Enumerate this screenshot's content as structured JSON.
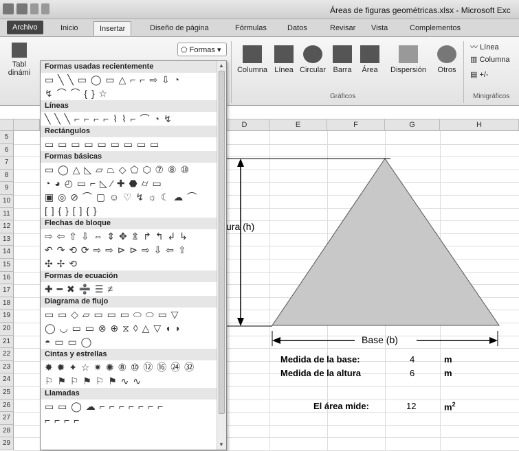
{
  "window": {
    "title": "Áreas de figuras geométricas.xlsx - Microsoft Exc"
  },
  "tabs": [
    "Archivo",
    "Inicio",
    "Insertar",
    "Diseño de página",
    "Fórmulas",
    "Datos",
    "Revisar",
    "Vista",
    "Complementos"
  ],
  "ribbon": {
    "tabla_line1": "Tabl",
    "tabla_line2": "dinámi",
    "formas_label": "Formas",
    "charts": [
      "Columna",
      "Línea",
      "Circular",
      "Barra",
      "Área",
      "Dispersión",
      "Otros"
    ],
    "charts_group": "Gráficos",
    "sparklines": [
      "Línea",
      "Columna",
      "+/-"
    ],
    "sparklines_group": "Minigráficos"
  },
  "shapes_panel": {
    "sections": [
      {
        "title": "Formas usadas recientemente",
        "glyphs": [
          "▭ ╲ ╲ ▭ ◯ ▭ △ ⌐ ⌐ ⇨ ⇩ ◔",
          "↯ ⌒ ⌒ { } ☆"
        ]
      },
      {
        "title": "Líneas",
        "glyphs": [
          "╲ ╲ ╲ ⌐ ⌐ ⌐ ⌐ ⌇ ⌇ ⌐ ⌒ ◔ ↯"
        ]
      },
      {
        "title": "Rectángulos",
        "glyphs": [
          "▭ ▭ ▭ ▭ ▭ ▭ ▭ ▭ ▭"
        ]
      },
      {
        "title": "Formas básicas",
        "glyphs": [
          "▭ ◯ △ ◺ ▱ ⏢ ◇ ⬠ ⬡ ⑦ ⑧ ⑩",
          "◔ ◕ ◴ ▭ ⌐ ◺ ⁄ ✚ ⬣ ⌭ ▭",
          "▣ ◎ ⊘ ⌒ ▢ ☺ ♡ ↯ ☼ ☾ ☁ ⌒",
          "[ ] { } [ ] { }"
        ]
      },
      {
        "title": "Flechas de bloque",
        "glyphs": [
          "⇨ ⇦ ⇧ ⇩ ⇔ ⇕ ✥ ⇭ ↱ ↰ ↲ ↳",
          "↶ ↷ ⟲ ⟳ ⇨ ⇨ ⊳ ⊳ ⇨ ⇩ ⇦ ⇧",
          "✣ ✢ ⟲"
        ]
      },
      {
        "title": "Formas de ecuación",
        "glyphs": [
          "✚ ━ ✖ ➗ ☰ ≠"
        ]
      },
      {
        "title": "Diagrama de flujo",
        "glyphs": [
          "▭ ▭ ◇ ▱ ▭ ▭ ▭ ⬭ ⬭ ▭ ▽",
          "◯ ◡ ▭ ▭ ⊗ ⊕ ⧖ ◊ △ ▽ ◖ ◗",
          "◓ ▭ ▭ ◯"
        ]
      },
      {
        "title": "Cintas y estrellas",
        "glyphs": [
          "✸ ✹ ✦ ☆ ✷ ✺ ⑧ ⑩ ⑫ ⑯ ㉔ ㉜",
          "⚐ ⚑ ⚐ ⚑ ⚐ ⚑ ∿ ∿"
        ]
      },
      {
        "title": "Llamadas",
        "glyphs": [
          "▭ ▭ ◯ ☁ ⌐ ⌐ ⌐ ⌐ ⌐ ⌐ ⌐",
          "⌐ ⌐ ⌐ ⌐"
        ]
      }
    ]
  },
  "sheet": {
    "columns": [
      "D",
      "E",
      "F",
      "G",
      "H"
    ],
    "rows": [
      "5",
      "6",
      "7",
      "8",
      "9",
      "10",
      "11",
      "12",
      "13",
      "14",
      "15",
      "16",
      "17",
      "18",
      "19",
      "20",
      "21",
      "22",
      "23",
      "24",
      "25",
      "26",
      "27",
      "28",
      "29"
    ],
    "altura_label": "ltura (h)",
    "base_label": "Base (b)",
    "medida_base_label": "Medida de la base:",
    "medida_base_value": "4",
    "medida_base_unit": "m",
    "medida_altura_label": "Medida de la altura",
    "medida_altura_value": "6",
    "medida_altura_unit": "m",
    "area_label": "El área mide:",
    "area_value": "12",
    "area_unit": "m",
    "area_unit_exp": "2"
  },
  "colors": {
    "triangle_fill": "#c8c8c8",
    "triangle_stroke": "#555555"
  }
}
